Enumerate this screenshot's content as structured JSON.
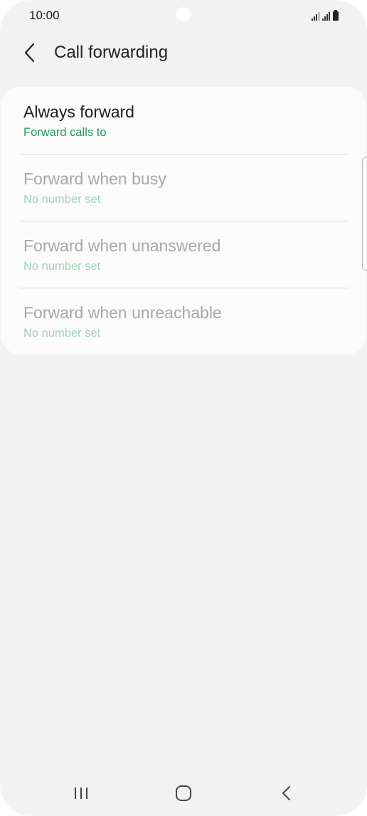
{
  "status_bar": {
    "time": "10:00"
  },
  "header": {
    "title": "Call forwarding",
    "back_icon": "chevron-left-icon"
  },
  "forwarding_options": [
    {
      "title": "Always forward",
      "subtitle": "Forward calls to",
      "enabled": true
    },
    {
      "title": "Forward when busy",
      "subtitle": "No number set",
      "enabled": false
    },
    {
      "title": "Forward when unanswered",
      "subtitle": "No number set",
      "enabled": false
    },
    {
      "title": "Forward when unreachable",
      "subtitle": "No number set",
      "enabled": false
    }
  ],
  "nav_bar": {
    "recents_icon": "recents-icon",
    "home_icon": "home-icon",
    "back_icon": "back-icon"
  },
  "colors": {
    "accent_green": "#1f9a5b",
    "disabled_green": "#9fd3b7",
    "background": "#f2f2f2",
    "card": "#fbfbfb"
  }
}
